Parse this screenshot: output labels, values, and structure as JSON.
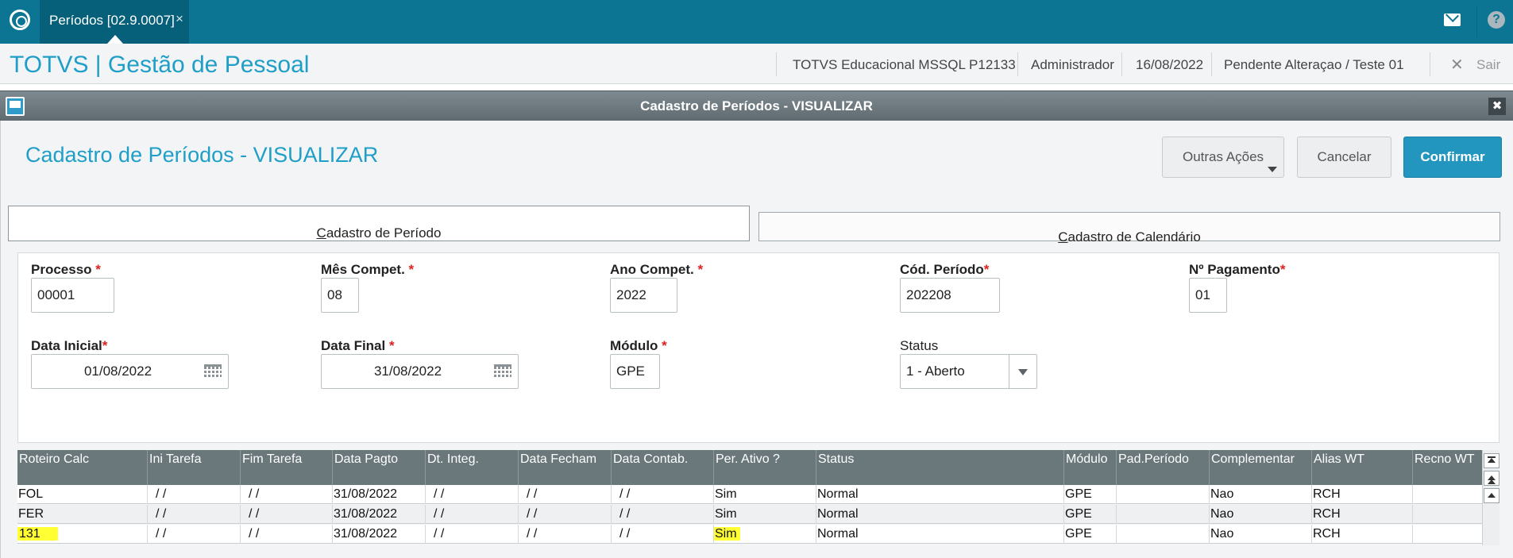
{
  "topbar": {
    "tab_label": "Períodos [02.9.0007]",
    "tab_close": "×",
    "help_symbol": "?"
  },
  "header": {
    "app_title": "TOTVS | Gestão de Pessoal",
    "environment": "TOTVS Educacional MSSQL P12133",
    "user": "Administrador",
    "date": "16/08/2022",
    "status": "Pendente Alteraçao / Teste 01",
    "exit_symbol": "✕",
    "exit_label": "Sair"
  },
  "dialog": {
    "title": "Cadastro de Períodos - VISUALIZAR",
    "close_symbol": "✖"
  },
  "page": {
    "title": "Cadastro de Períodos - VISUALIZAR",
    "buttons": {
      "other_actions": "Outras Ações",
      "cancel": "Cancelar",
      "confirm": "Confirmar"
    }
  },
  "tabs": [
    {
      "accel": "C",
      "rest": "adastro de Período",
      "active": true
    },
    {
      "accel": "C",
      "rest": "adastro de Calendário",
      "active": false
    }
  ],
  "form": {
    "processo": {
      "label": "Processo ",
      "required": "*",
      "value": "00001"
    },
    "mes_compet": {
      "label": "Mês Compet. ",
      "required": "*",
      "value": "08"
    },
    "ano_compet": {
      "label": "Ano Compet. ",
      "required": "*",
      "value": "2022"
    },
    "cod_periodo": {
      "label": "Cód. Período",
      "required": "*",
      "value": "202208"
    },
    "n_pagamento": {
      "label": "Nº Pagamento",
      "required": "*",
      "value": "01"
    },
    "data_inicial": {
      "label": "Data Inicial",
      "required": "*",
      "value": "01/08/2022"
    },
    "data_final": {
      "label": "Data Final ",
      "required": "*",
      "value": "31/08/2022"
    },
    "modulo": {
      "label": "Módulo ",
      "required": "*",
      "value": "GPE"
    },
    "status": {
      "label": "Status",
      "value": "1 - Aberto"
    }
  },
  "grid": {
    "columns": [
      "Roteiro Calc",
      "Ini Tarefa",
      "Fim Tarefa",
      "Data Pagto",
      "Dt. Integ.",
      "Data Fecham",
      "Data Contab.",
      "Per. Ativo ?",
      "Status",
      "Módulo",
      "Pad.Período",
      "Complementar",
      "Alias WT",
      "Recno WT"
    ],
    "rows": [
      {
        "cells": [
          "FOL",
          " /  /",
          " /  /",
          "31/08/2022",
          " /  /",
          " /  /",
          " /  /",
          "Sim",
          "Normal",
          "GPE",
          "",
          "Nao",
          "RCH",
          ""
        ]
      },
      {
        "cells": [
          "FER",
          " /  /",
          " /  /",
          "31/08/2022",
          " /  /",
          " /  /",
          " /  /",
          "Sim",
          "Normal",
          "GPE",
          "",
          "Nao",
          "RCH",
          ""
        ]
      },
      {
        "cells": [
          "131",
          " /  /",
          " /  /",
          "31/08/2022",
          " /  /",
          " /  /",
          " /  /",
          "Sim",
          "Normal",
          "GPE",
          "",
          "Nao",
          "RCH",
          ""
        ]
      }
    ],
    "highlight_color": "#ffff33"
  },
  "colors": {
    "topbar": "#0b7593",
    "accent": "#1f9ec7",
    "primary_button": "#2296bf",
    "required": "#e0201f",
    "grid_header": "#6a777b"
  }
}
